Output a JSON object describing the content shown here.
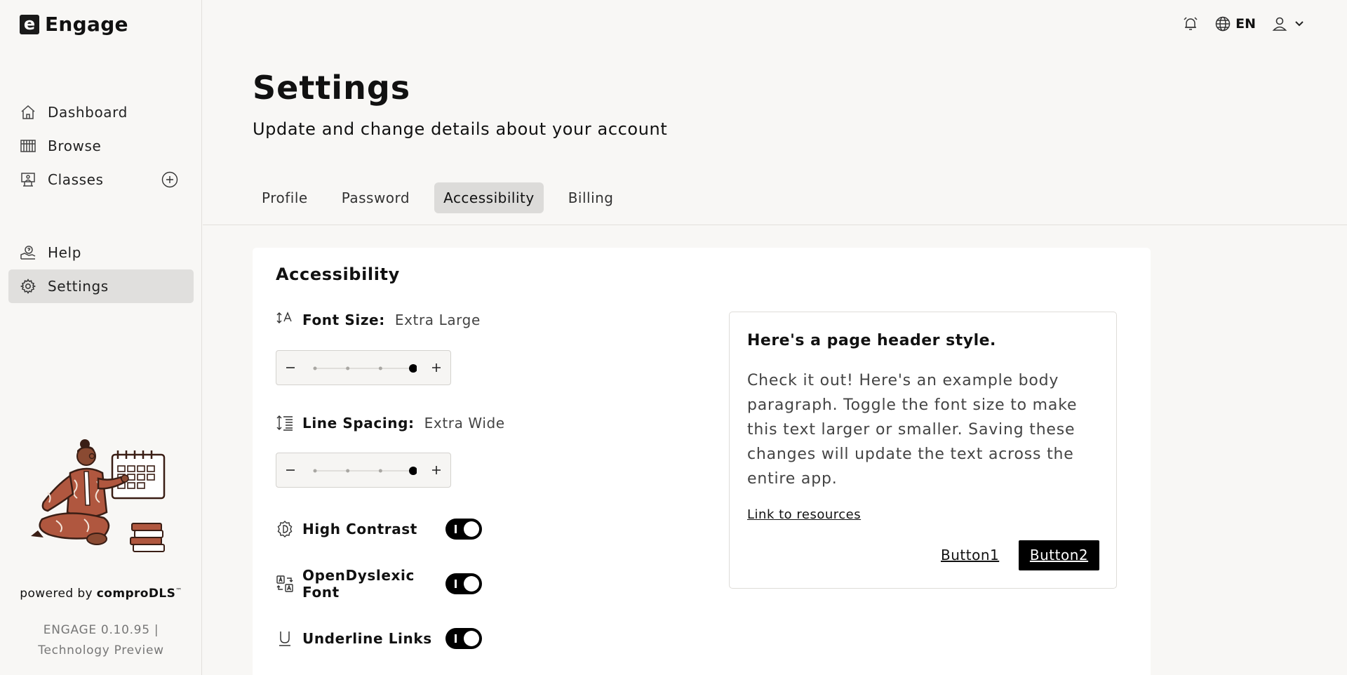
{
  "app": {
    "logo_letter": "e",
    "name": "Engage"
  },
  "sidebar": {
    "items": [
      {
        "label": "Dashboard",
        "icon": "home-icon"
      },
      {
        "label": "Browse",
        "icon": "library-icon"
      },
      {
        "label": "Classes",
        "icon": "classroom-icon"
      },
      {
        "label": "Help",
        "icon": "help-icon"
      },
      {
        "label": "Settings",
        "icon": "gear-icon"
      }
    ],
    "powered_by": "powered by ",
    "powered_brand": "comproDLS",
    "powered_tm": "™",
    "version_line1": "ENGAGE 0.10.95 |",
    "version_line2": "Technology Preview"
  },
  "topbar": {
    "language": "EN"
  },
  "header": {
    "title": "Settings",
    "subtitle": "Update and change details about your account"
  },
  "tabs": [
    {
      "label": "Profile"
    },
    {
      "label": "Password"
    },
    {
      "label": "Accessibility",
      "active": true
    },
    {
      "label": "Billing"
    }
  ],
  "accessibility": {
    "title": "Accessibility",
    "font_size": {
      "label": "Font Size:",
      "value": "Extra Large",
      "level": 4,
      "levels": 4
    },
    "line_spacing": {
      "label": "Line Spacing:",
      "value": "Extra Wide",
      "level": 4,
      "levels": 4
    },
    "toggles": [
      {
        "label": "High Contrast",
        "on": true
      },
      {
        "label": "OpenDyslexic Font",
        "on": true
      },
      {
        "label": "Underline Links",
        "on": true
      }
    ]
  },
  "preview": {
    "heading": "Here's a page header style.",
    "body": "Check it out! Here's an example body paragraph. Toggle the font size to make this text larger or smaller. Saving these changes will update the text across the entire app.",
    "link": "Link to resources",
    "button1": "Button1",
    "button2": "Button2"
  }
}
